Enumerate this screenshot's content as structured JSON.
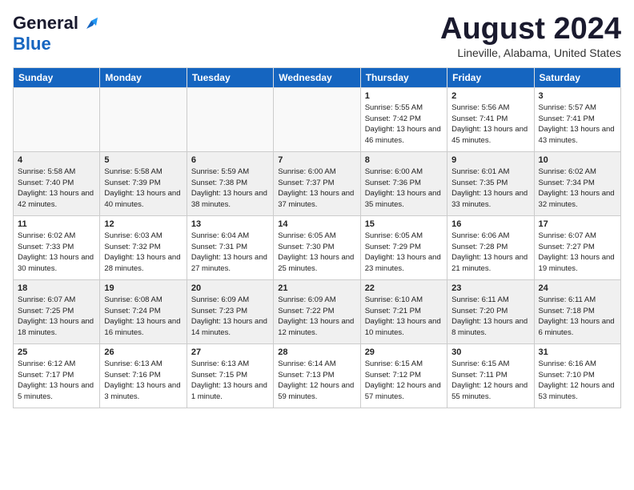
{
  "header": {
    "logo_general": "General",
    "logo_blue": "Blue",
    "month_title": "August 2024",
    "location": "Lineville, Alabama, United States"
  },
  "days_of_week": [
    "Sunday",
    "Monday",
    "Tuesday",
    "Wednesday",
    "Thursday",
    "Friday",
    "Saturday"
  ],
  "weeks": [
    [
      {
        "day": "",
        "empty": true
      },
      {
        "day": "",
        "empty": true
      },
      {
        "day": "",
        "empty": true
      },
      {
        "day": "",
        "empty": true
      },
      {
        "day": "1",
        "sunrise": "5:55 AM",
        "sunset": "7:42 PM",
        "daylight": "13 hours and 46 minutes."
      },
      {
        "day": "2",
        "sunrise": "5:56 AM",
        "sunset": "7:41 PM",
        "daylight": "13 hours and 45 minutes."
      },
      {
        "day": "3",
        "sunrise": "5:57 AM",
        "sunset": "7:41 PM",
        "daylight": "13 hours and 43 minutes."
      }
    ],
    [
      {
        "day": "4",
        "sunrise": "5:58 AM",
        "sunset": "7:40 PM",
        "daylight": "13 hours and 42 minutes."
      },
      {
        "day": "5",
        "sunrise": "5:58 AM",
        "sunset": "7:39 PM",
        "daylight": "13 hours and 40 minutes."
      },
      {
        "day": "6",
        "sunrise": "5:59 AM",
        "sunset": "7:38 PM",
        "daylight": "13 hours and 38 minutes."
      },
      {
        "day": "7",
        "sunrise": "6:00 AM",
        "sunset": "7:37 PM",
        "daylight": "13 hours and 37 minutes."
      },
      {
        "day": "8",
        "sunrise": "6:00 AM",
        "sunset": "7:36 PM",
        "daylight": "13 hours and 35 minutes."
      },
      {
        "day": "9",
        "sunrise": "6:01 AM",
        "sunset": "7:35 PM",
        "daylight": "13 hours and 33 minutes."
      },
      {
        "day": "10",
        "sunrise": "6:02 AM",
        "sunset": "7:34 PM",
        "daylight": "13 hours and 32 minutes."
      }
    ],
    [
      {
        "day": "11",
        "sunrise": "6:02 AM",
        "sunset": "7:33 PM",
        "daylight": "13 hours and 30 minutes."
      },
      {
        "day": "12",
        "sunrise": "6:03 AM",
        "sunset": "7:32 PM",
        "daylight": "13 hours and 28 minutes."
      },
      {
        "day": "13",
        "sunrise": "6:04 AM",
        "sunset": "7:31 PM",
        "daylight": "13 hours and 27 minutes."
      },
      {
        "day": "14",
        "sunrise": "6:05 AM",
        "sunset": "7:30 PM",
        "daylight": "13 hours and 25 minutes."
      },
      {
        "day": "15",
        "sunrise": "6:05 AM",
        "sunset": "7:29 PM",
        "daylight": "13 hours and 23 minutes."
      },
      {
        "day": "16",
        "sunrise": "6:06 AM",
        "sunset": "7:28 PM",
        "daylight": "13 hours and 21 minutes."
      },
      {
        "day": "17",
        "sunrise": "6:07 AM",
        "sunset": "7:27 PM",
        "daylight": "13 hours and 19 minutes."
      }
    ],
    [
      {
        "day": "18",
        "sunrise": "6:07 AM",
        "sunset": "7:25 PM",
        "daylight": "13 hours and 18 minutes."
      },
      {
        "day": "19",
        "sunrise": "6:08 AM",
        "sunset": "7:24 PM",
        "daylight": "13 hours and 16 minutes."
      },
      {
        "day": "20",
        "sunrise": "6:09 AM",
        "sunset": "7:23 PM",
        "daylight": "13 hours and 14 minutes."
      },
      {
        "day": "21",
        "sunrise": "6:09 AM",
        "sunset": "7:22 PM",
        "daylight": "13 hours and 12 minutes."
      },
      {
        "day": "22",
        "sunrise": "6:10 AM",
        "sunset": "7:21 PM",
        "daylight": "13 hours and 10 minutes."
      },
      {
        "day": "23",
        "sunrise": "6:11 AM",
        "sunset": "7:20 PM",
        "daylight": "13 hours and 8 minutes."
      },
      {
        "day": "24",
        "sunrise": "6:11 AM",
        "sunset": "7:18 PM",
        "daylight": "13 hours and 6 minutes."
      }
    ],
    [
      {
        "day": "25",
        "sunrise": "6:12 AM",
        "sunset": "7:17 PM",
        "daylight": "13 hours and 5 minutes."
      },
      {
        "day": "26",
        "sunrise": "6:13 AM",
        "sunset": "7:16 PM",
        "daylight": "13 hours and 3 minutes."
      },
      {
        "day": "27",
        "sunrise": "6:13 AM",
        "sunset": "7:15 PM",
        "daylight": "13 hours and 1 minute."
      },
      {
        "day": "28",
        "sunrise": "6:14 AM",
        "sunset": "7:13 PM",
        "daylight": "12 hours and 59 minutes."
      },
      {
        "day": "29",
        "sunrise": "6:15 AM",
        "sunset": "7:12 PM",
        "daylight": "12 hours and 57 minutes."
      },
      {
        "day": "30",
        "sunrise": "6:15 AM",
        "sunset": "7:11 PM",
        "daylight": "12 hours and 55 minutes."
      },
      {
        "day": "31",
        "sunrise": "6:16 AM",
        "sunset": "7:10 PM",
        "daylight": "12 hours and 53 minutes."
      }
    ]
  ]
}
